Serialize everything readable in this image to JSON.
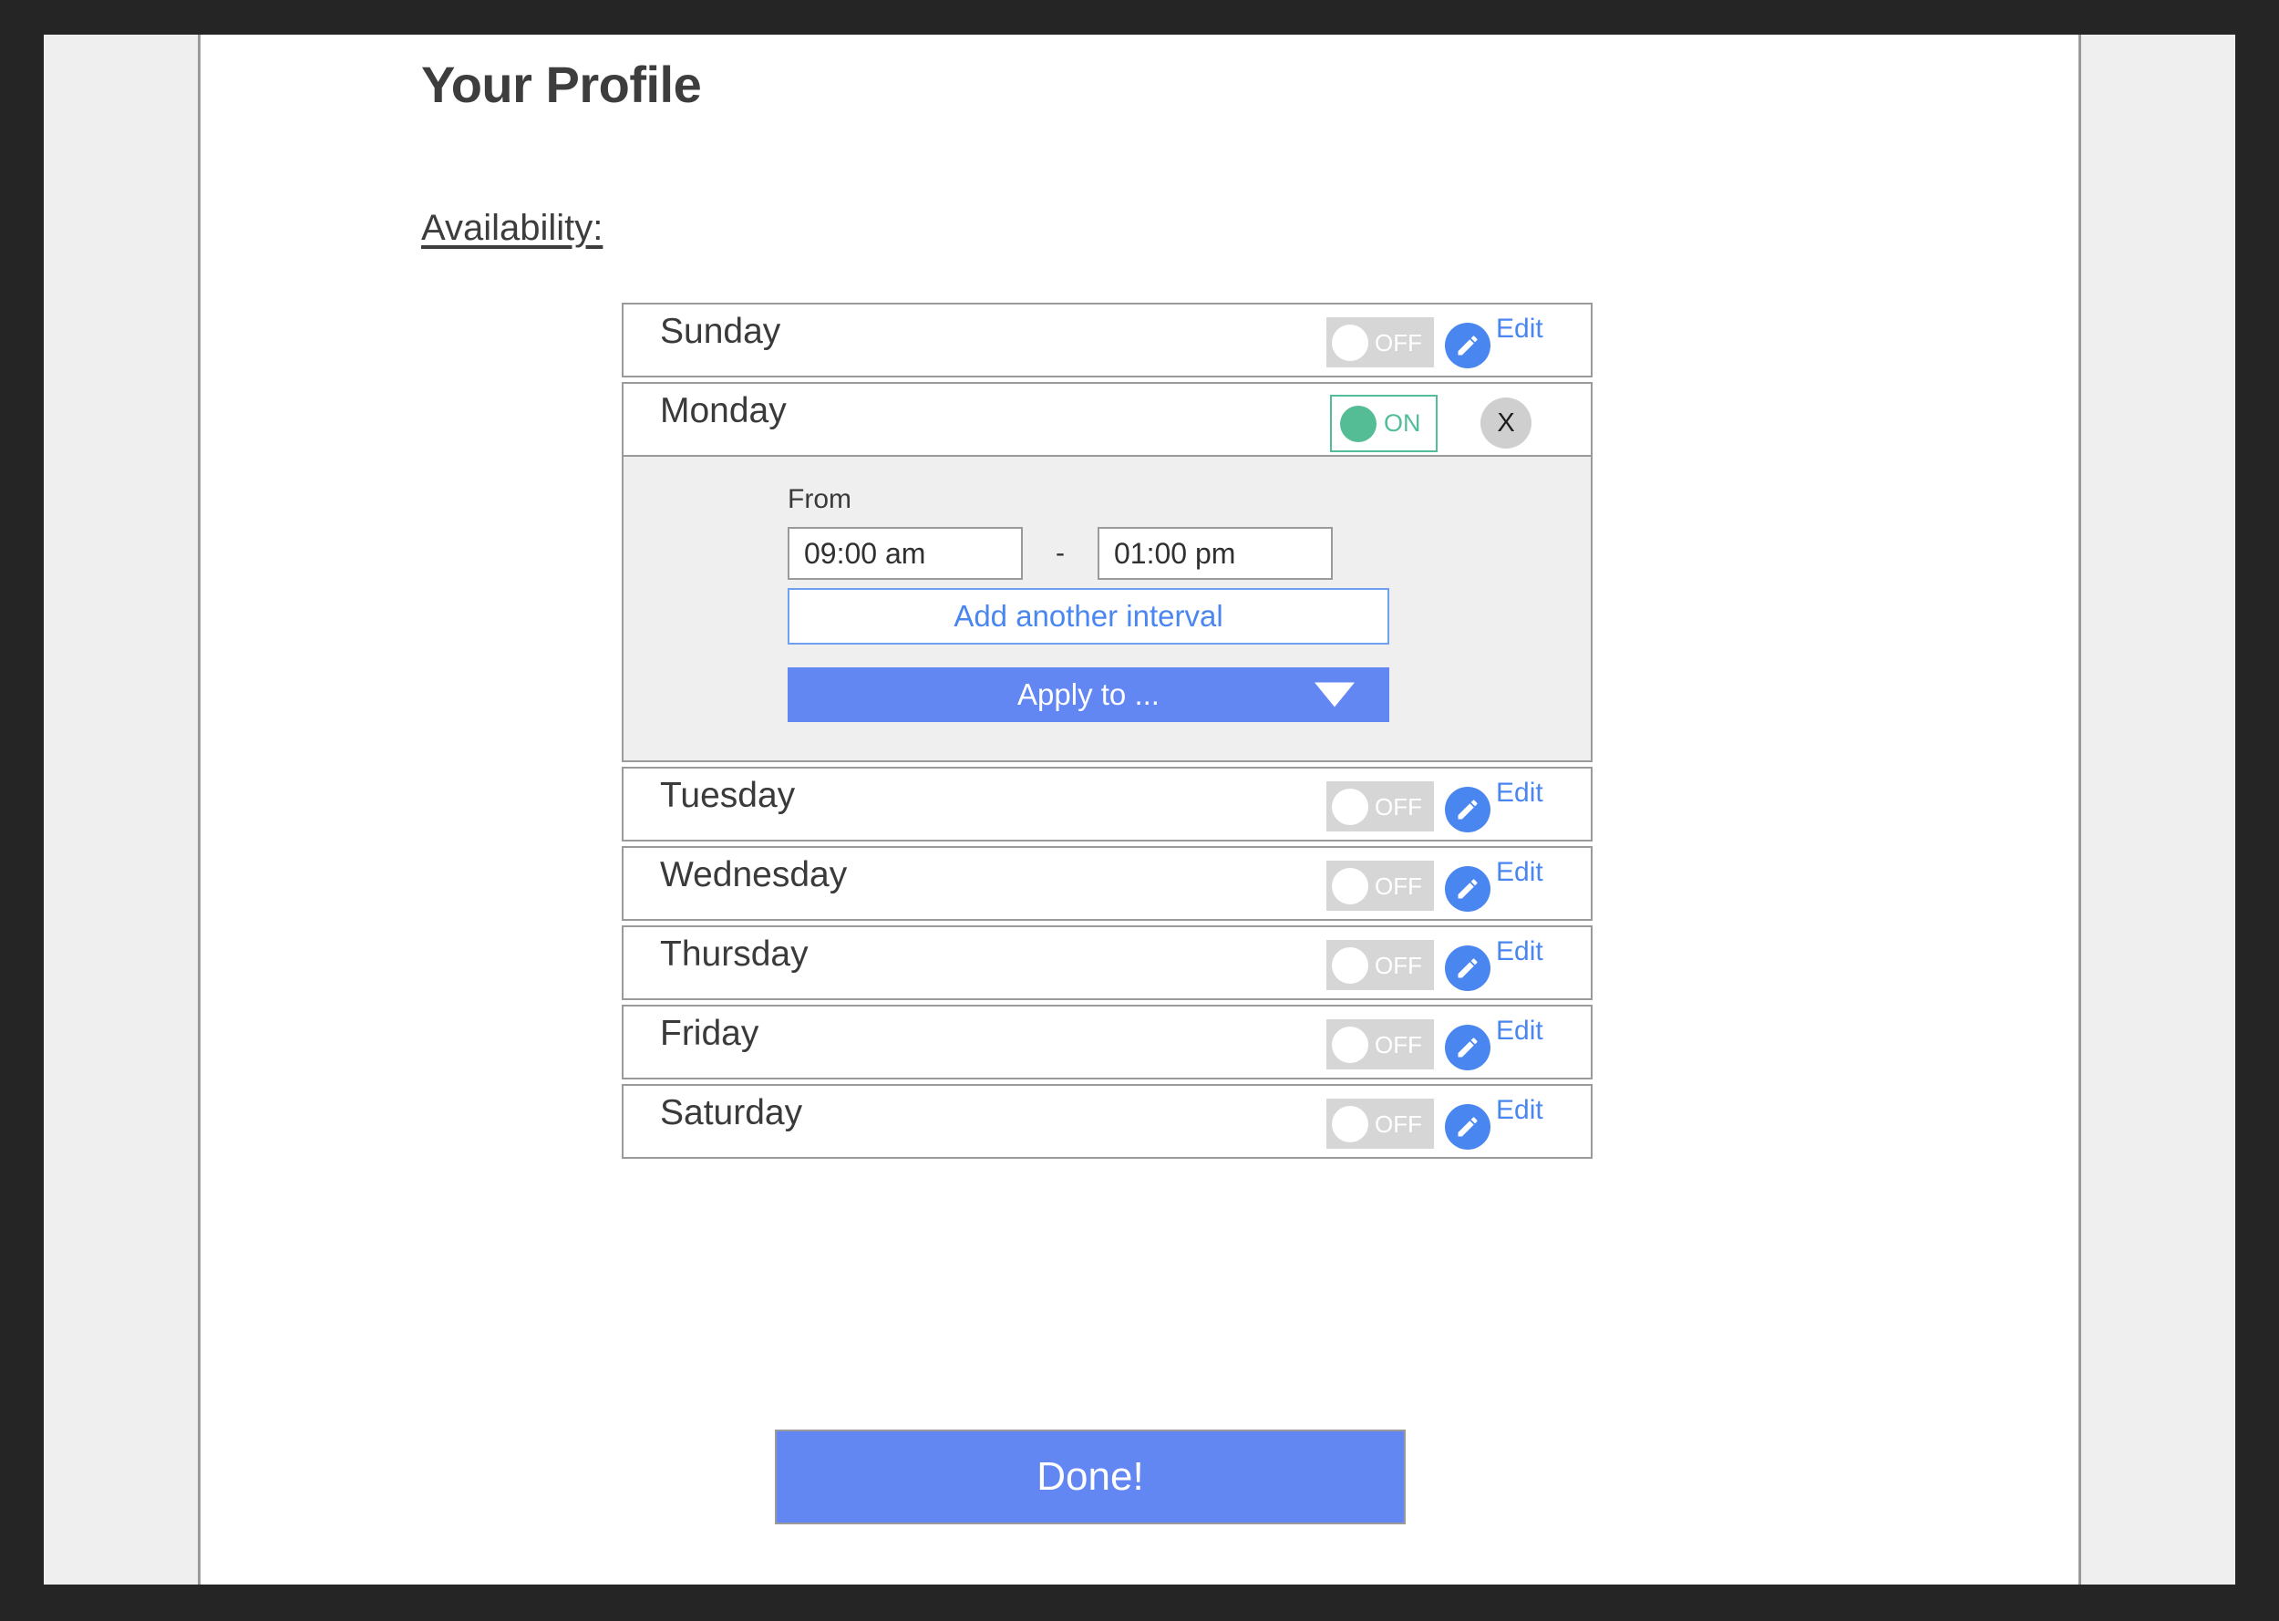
{
  "header": {
    "title": "Your Profile",
    "section_label": "Availability:"
  },
  "toggle_labels": {
    "on": "ON",
    "off": "OFF"
  },
  "actions": {
    "edit_label": "Edit",
    "close_label": "X",
    "done_label": "Done!"
  },
  "schedule": {
    "days": [
      {
        "name": "Sunday",
        "state": "OFF"
      },
      {
        "name": "Monday",
        "state": "ON"
      },
      {
        "name": "Tuesday",
        "state": "OFF"
      },
      {
        "name": "Wednesday",
        "state": "OFF"
      },
      {
        "name": "Thursday",
        "state": "OFF"
      },
      {
        "name": "Friday",
        "state": "OFF"
      },
      {
        "name": "Saturday",
        "state": "OFF"
      }
    ],
    "expanded_day": "Monday",
    "editor": {
      "from_label": "From",
      "start_time": "09:00 am",
      "separator": "-",
      "end_time": "01:00 pm",
      "add_interval_label": "Add another interval",
      "apply_to_label": "Apply to ..."
    }
  },
  "colors": {
    "accent_blue": "#6286f2",
    "link_blue": "#4a86f0",
    "toggle_on_green": "#53bd97",
    "toggle_off_gray": "#d6d6d6",
    "panel_gray": "#efefef",
    "frame_dark": "#252525"
  }
}
